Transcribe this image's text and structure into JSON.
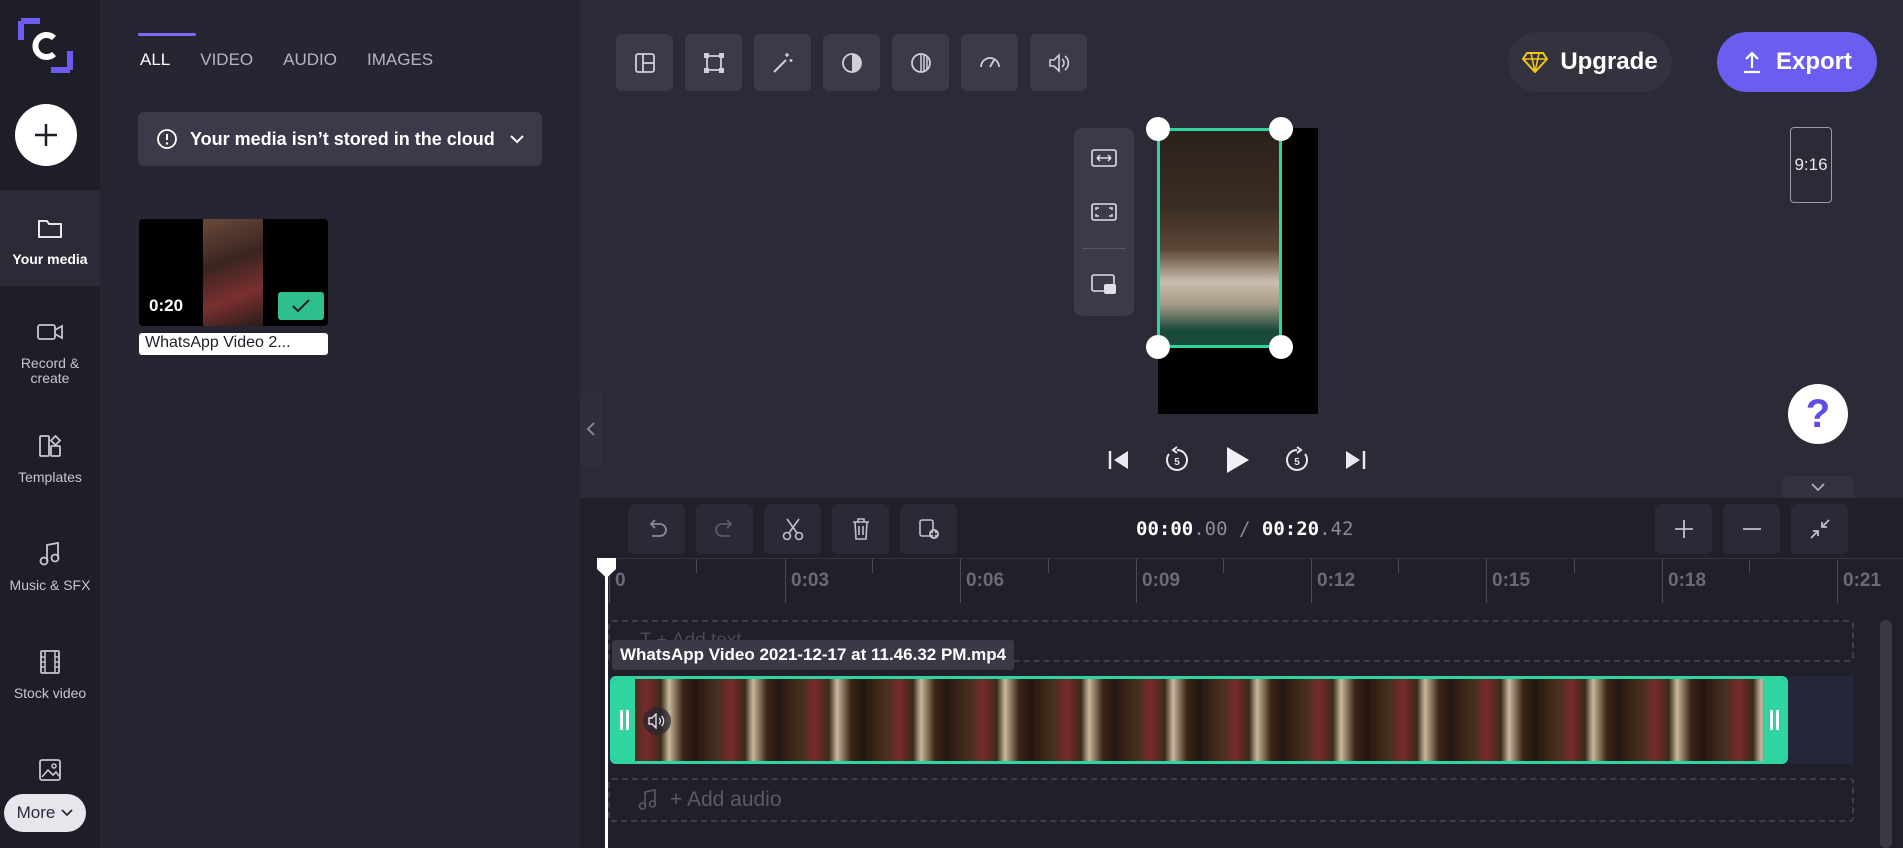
{
  "sidebar": {
    "items": [
      {
        "label": "Your media",
        "icon": "folder-icon"
      },
      {
        "label": "Record & create",
        "icon": "video-camera-icon"
      },
      {
        "label": "Templates",
        "icon": "templates-icon"
      },
      {
        "label": "Music & SFX",
        "icon": "music-note-icon"
      },
      {
        "label": "Stock video",
        "icon": "film-icon"
      },
      {
        "label": "",
        "icon": "image-icon"
      }
    ],
    "more_label": "More"
  },
  "media": {
    "tabs": [
      {
        "label": "ALL"
      },
      {
        "label": "VIDEO"
      },
      {
        "label": "AUDIO"
      },
      {
        "label": "IMAGES"
      }
    ],
    "cloud_notice": "Your media isn’t stored in the cloud",
    "item": {
      "duration": "0:20",
      "name": "WhatsApp Video 2..."
    }
  },
  "header": {
    "upgrade_label": "Upgrade",
    "export_label": "Export"
  },
  "preview": {
    "aspect_ratio": "9:16",
    "help_label": "?"
  },
  "timeline": {
    "current_time": "00:00",
    "current_frac": ".00",
    "separator": "/",
    "total_time": "00:20",
    "total_frac": ".42",
    "ticks": [
      "0",
      "0:03",
      "0:06",
      "0:09",
      "0:12",
      "0:15",
      "0:18",
      "0:21"
    ],
    "add_text_label": "T  + Add text",
    "clip_name": "WhatsApp Video 2021-12-17 at 11.46.32 PM.mp4",
    "add_audio_label": "+ Add audio"
  },
  "colors": {
    "accent": "#6a5df0",
    "selection": "#2fd4a0",
    "upgrade_gem": "#f5c518"
  }
}
